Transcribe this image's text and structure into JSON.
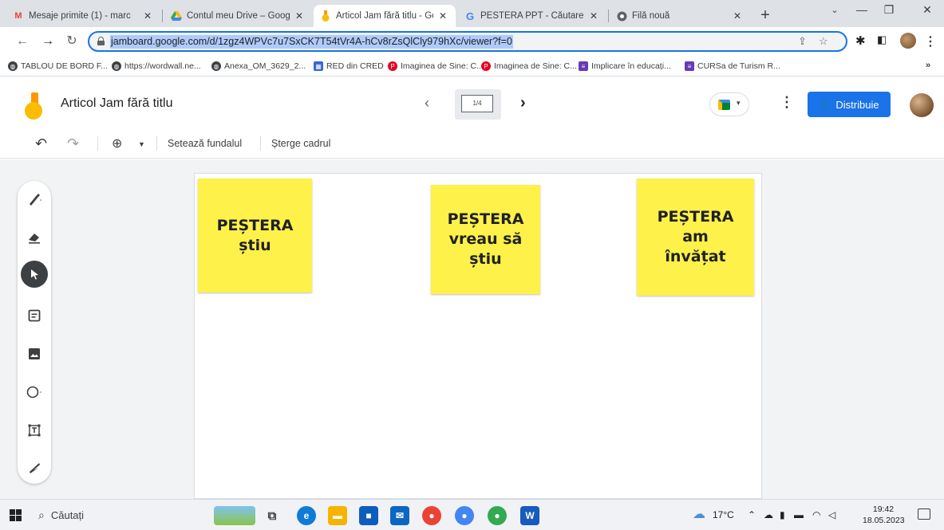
{
  "browser": {
    "tabs": [
      {
        "title": "Mesaje primite (1) - marc",
        "favicon": "gmail-icon",
        "active": false
      },
      {
        "title": "Contul meu Drive – Goog",
        "favicon": "drive-icon",
        "active": false
      },
      {
        "title": "Articol Jam fără titlu - Go",
        "favicon": "jamboard-icon",
        "active": true
      },
      {
        "title": "PESTERA PPT - Căutare G",
        "favicon": "google-icon",
        "active": false
      },
      {
        "title": "Filă nouă",
        "favicon": "chrome-icon",
        "active": false
      }
    ],
    "url": "jamboard.google.com/d/1zgz4WPVc7u7SxCK7T54tVr4A-hCv8rZsQlCly979hXc/viewer?f=0",
    "bookmarks": [
      {
        "label": "TABLOU DE BORD F...",
        "icon": "globe-icon",
        "color": "#3c4043"
      },
      {
        "label": "https://wordwall.ne...",
        "icon": "globe-icon",
        "color": "#3c4043"
      },
      {
        "label": "Anexa_OM_3629_2...",
        "icon": "globe-icon",
        "color": "#3c4043"
      },
      {
        "label": "RED din CRED",
        "icon": "calendar-icon",
        "color": "#3367d6"
      },
      {
        "label": "Imaginea de Sine: C...",
        "icon": "pinterest-icon",
        "color": "#e60023"
      },
      {
        "label": "Imaginea de Sine: C...",
        "icon": "pinterest-icon",
        "color": "#e60023"
      },
      {
        "label": "Implicare în educați...",
        "icon": "forms-icon",
        "color": "#673ab7"
      },
      {
        "label": "CURSa de Turism R...",
        "icon": "forms-icon",
        "color": "#673ab7"
      }
    ],
    "bookmarks_more": "»"
  },
  "app": {
    "title": "Articol Jam fără titlu",
    "frame_indicator": "1/4",
    "share_label": "Distribuie",
    "brand_color": "#1a73e8"
  },
  "toolbar": {
    "undo_icon": "undo-icon",
    "redo_icon": "redo-icon",
    "zoom_icon": "zoom-in-icon",
    "set_background": "Setează fundalul",
    "clear_frame": "Șterge cadrul"
  },
  "tools": [
    {
      "name": "pen-icon",
      "selected": false
    },
    {
      "name": "eraser-icon",
      "selected": false
    },
    {
      "name": "select-icon",
      "selected": true
    },
    {
      "name": "sticky-note-icon",
      "selected": false
    },
    {
      "name": "image-icon",
      "selected": false
    },
    {
      "name": "circle-icon",
      "selected": false
    },
    {
      "name": "text-box-icon",
      "selected": false
    },
    {
      "name": "laser-icon",
      "selected": false
    }
  ],
  "stickies": [
    {
      "text": "PEȘTERA\nștiu",
      "color": "#fef14a"
    },
    {
      "text": "PEȘTERA\nvreau să\nștiu",
      "color": "#fef14a"
    },
    {
      "text": "PEȘTERA\nam\nînvățat",
      "color": "#fef14a"
    }
  ],
  "taskbar": {
    "search_label": "Căutați",
    "weather": "17°C",
    "time": "19:42",
    "date": "18.05.2023"
  }
}
